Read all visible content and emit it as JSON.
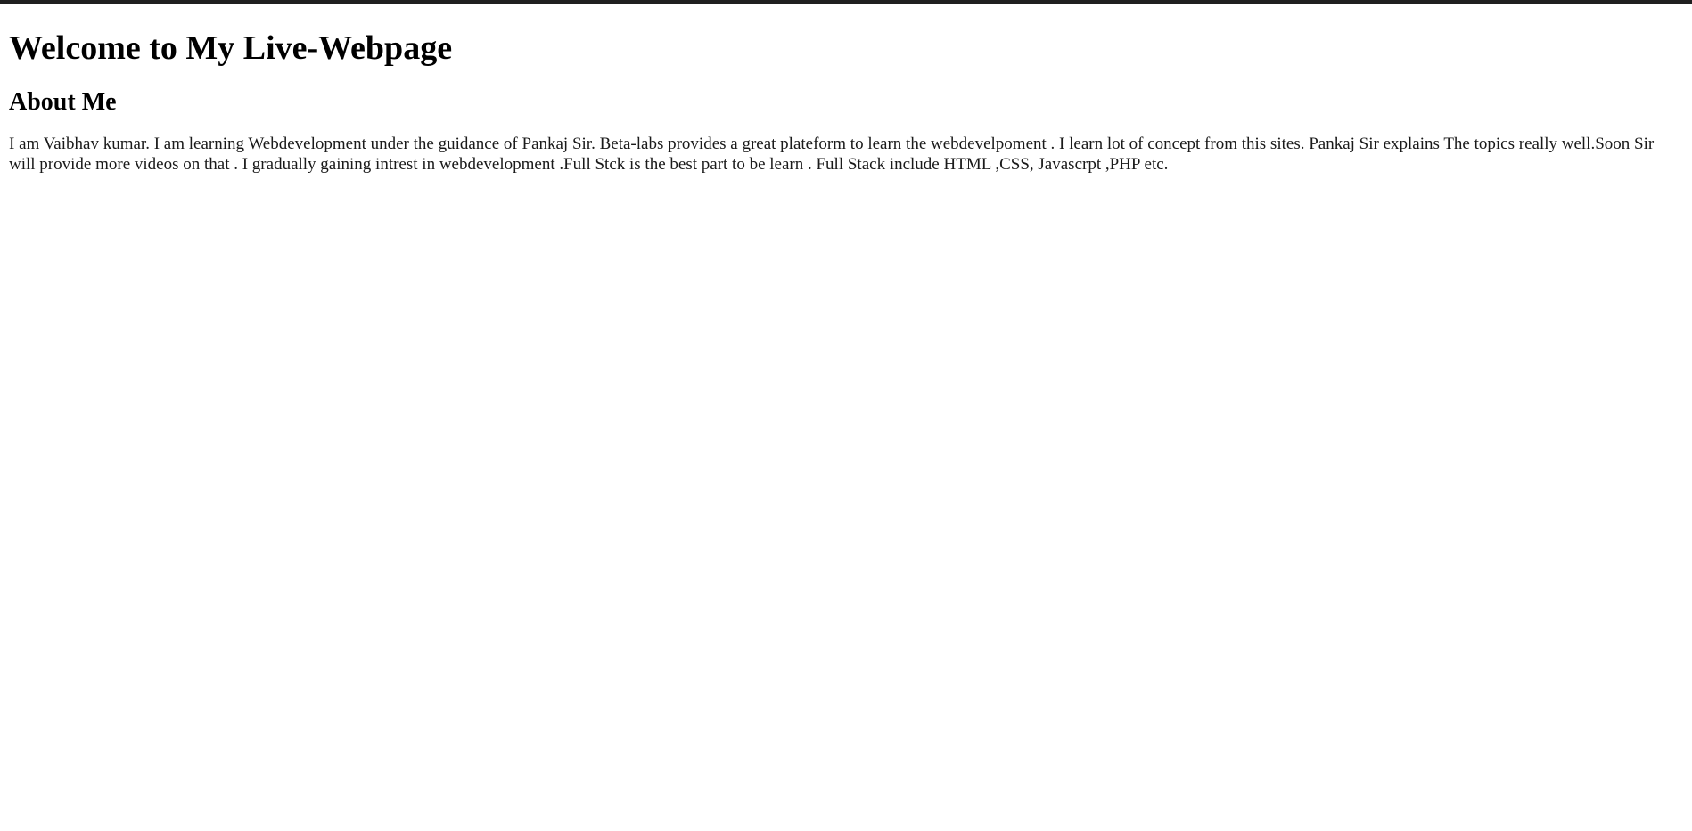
{
  "page": {
    "title": "Welcome to My Live-Webpage",
    "section_heading": "About Me",
    "about_text": "I am Vaibhav kumar. I am learning Webdevelopment under the guidance of Pankaj Sir. Beta-labs provides a great plateform to learn the webdevelpoment . I learn lot of concept from this sites. Pankaj Sir explains The topics really well.Soon Sir will provide more videos on that . I gradually gaining intrest in webdevelopment .Full Stck is the best part to be learn . Full Stack include HTML ,CSS, Javascrpt ,PHP etc."
  }
}
